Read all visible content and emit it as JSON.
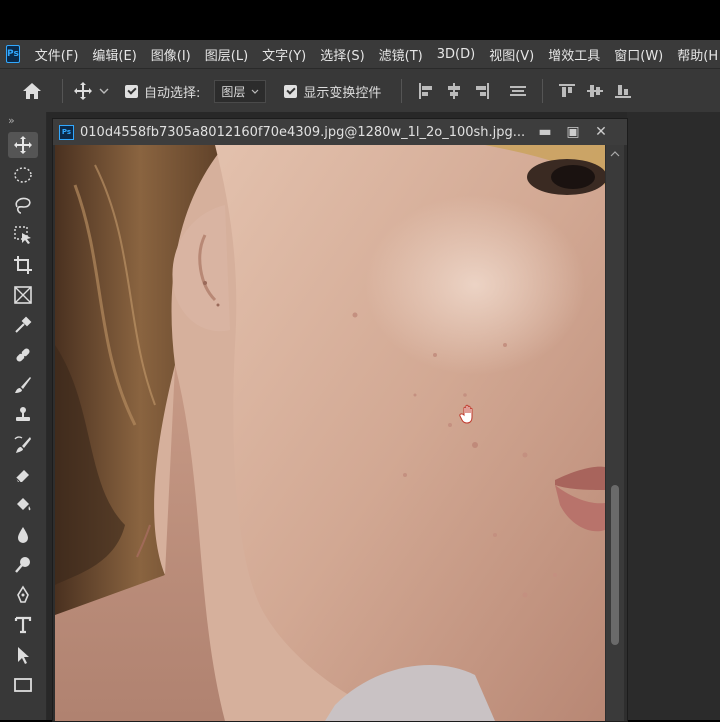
{
  "menubar": {
    "logo": "Ps",
    "items": [
      "文件(F)",
      "编辑(E)",
      "图像(I)",
      "图层(L)",
      "文字(Y)",
      "选择(S)",
      "滤镜(T)",
      "3D(D)",
      "视图(V)",
      "增效工具",
      "窗口(W)",
      "帮助(H"
    ]
  },
  "options": {
    "auto_select_label": "自动选择:",
    "auto_select_value": "图层",
    "show_transform_label": "显示变换控件"
  },
  "toolbar": {
    "collapse_glyph": "»"
  },
  "document": {
    "logo": "Ps",
    "title": "010d4558fb7305a8012160f70e4309.jpg@1280w_1l_2o_100sh.jpg...",
    "minimize": "▬",
    "maximize": "▣",
    "close": "✕"
  },
  "colors": {
    "skin": "#d4ad98",
    "hair": "#6b4a2e",
    "background": "#2e2e2e",
    "accent": "#31a8ff"
  }
}
